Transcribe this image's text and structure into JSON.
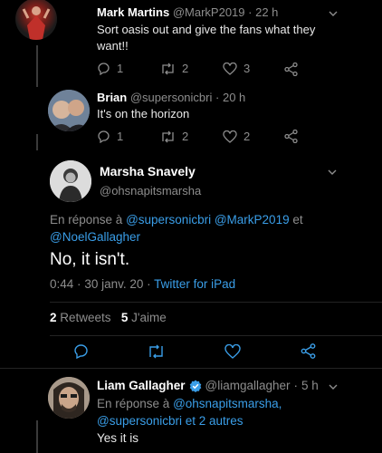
{
  "tweet1": {
    "name": "Mark Martins",
    "handle": "@MarkP2019",
    "sep": "·",
    "time": "22 h",
    "text1": "Sort oasis out and give the fans what they",
    "text2": "want!!",
    "replies": "1",
    "retweets": "2",
    "likes": "3"
  },
  "tweet2": {
    "name": "Brian",
    "handle": "@supersonicbri",
    "sep": "·",
    "time": "20 h",
    "text": "It's on the horizon",
    "replies": "1",
    "retweets": "2",
    "likes": "2"
  },
  "main": {
    "name": "Marsha Snavely",
    "handle": "@ohsnapitsmarsha",
    "reply_prefix": "En réponse à",
    "mention1": "@supersonicbri",
    "mention2": "@MarkP2019",
    "and": "et",
    "mention3": "@NoelGallagher",
    "text": "No, it isn't.",
    "time": "0:44",
    "date": "30 janv. 20",
    "sep": "·",
    "source": "Twitter for iPad",
    "retweets_count": "2",
    "retweets_label": "Retweets",
    "likes_count": "5",
    "likes_label": "J'aime"
  },
  "tweet3": {
    "name": "Liam Gallagher",
    "handle": "@liamgallagher",
    "sep": "·",
    "time": "5 h",
    "reply_prefix": "En réponse à",
    "mention1": "@ohsnapitsmarsha,",
    "mention2": "@supersonicbri",
    "rest": "et 2 autres",
    "text": "Yes it is"
  },
  "colors": {
    "background": "#000000",
    "link": "#3a9ee8",
    "muted": "#8d8d8d",
    "verified": "#3a9ee8"
  }
}
